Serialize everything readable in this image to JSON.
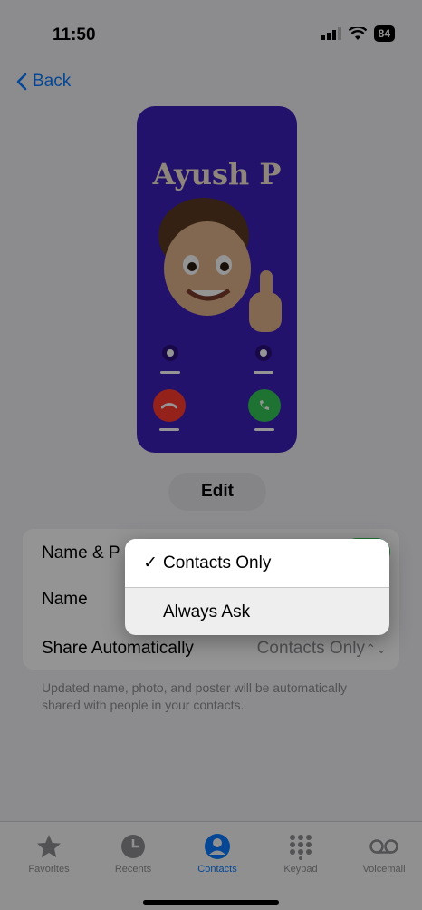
{
  "status_bar": {
    "time": "11:50",
    "battery": "84"
  },
  "nav": {
    "back_label": "Back"
  },
  "poster": {
    "name": "Ayush P",
    "background": "#3d1fb8"
  },
  "edit_label": "Edit",
  "settings": {
    "rows": [
      {
        "label": "Name & P",
        "control": "toggle",
        "on": true
      },
      {
        "label": "Name"
      },
      {
        "label": "Share Automatically",
        "value": "Contacts Only"
      }
    ]
  },
  "footnote": "Updated name, photo, and poster will be automatically shared with people in your contacts.",
  "menu": {
    "items": [
      {
        "check": "✓",
        "label": "Contacts Only",
        "selected": true
      },
      {
        "check": "",
        "label": "Always Ask",
        "selected": false
      }
    ]
  },
  "tabs": [
    {
      "label": "Favorites",
      "icon": "star-icon",
      "active": false
    },
    {
      "label": "Recents",
      "icon": "clock-icon",
      "active": false
    },
    {
      "label": "Contacts",
      "icon": "person-circle-icon",
      "active": true
    },
    {
      "label": "Keypad",
      "icon": "keypad-icon",
      "active": false
    },
    {
      "label": "Voicemail",
      "icon": "voicemail-icon",
      "active": false
    }
  ],
  "colors": {
    "accent": "#0a7aff",
    "toggle_on": "#34c759",
    "decline": "#ff3b30",
    "accept": "#34c759"
  }
}
